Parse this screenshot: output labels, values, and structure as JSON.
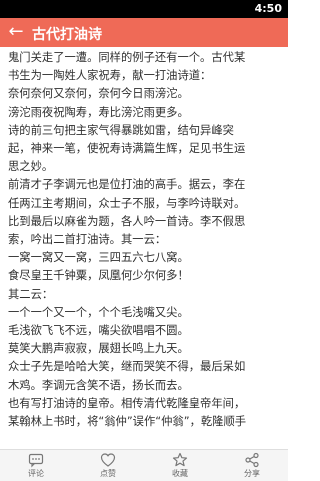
{
  "status_bar": {
    "time": "4:50"
  },
  "app_bar": {
    "title": "古代打油诗"
  },
  "content": {
    "lines": [
      "鬼门关走了一遭。同样的例子还有一个。古代某",
      "书生为一陶姓人家祝寿，献一打油诗道：",
      "奈何奈何又奈何，奈何今日雨滂沱。",
      "滂沱雨夜祝陶寿，寿比滂沱雨更多。",
      "诗的前三句把主家气得暴跳如雷，结句异峰突",
      "起，神来一笔，使祝寿诗满篇生辉，足见书生运",
      "思之妙。",
      "前清才子李调元也是位打油的高手。据云，李在",
      "任两江主考期间，众士子不服，与李吟诗联对。",
      "比到最后以麻雀为题，各人吟一首诗。李不假思",
      "索，吟出二首打油诗。其一云：",
      "一窝一窝又一窝，三四五六七八窝。",
      "食尽皇王千钟粟，凤凰何少尔何多！",
      "其二云：",
      "一个一个又一个，个个毛浅嘴又尖。",
      "毛浅欲飞飞不远，嘴尖欲唱唱不圆。",
      "莫笑大鹏声寂寂，展翅长鸣上九天。",
      "众士子先是哈哈大笑，继而哭笑不得，最后呆如",
      "木鸡。李调元含笑不语，扬长而去。",
      "也有写打油诗的皇帝。相传清代乾隆皇帝年间，",
      "某翰林上书时，将“翁仲”误作“仲翁”，乾隆顺手"
    ]
  },
  "bottom_bar": {
    "tabs": [
      {
        "label": "评论",
        "icon": "comment-icon"
      },
      {
        "label": "点赞",
        "icon": "heart-icon"
      },
      {
        "label": "收藏",
        "icon": "star-icon"
      },
      {
        "label": "分享",
        "icon": "share-icon"
      }
    ]
  }
}
